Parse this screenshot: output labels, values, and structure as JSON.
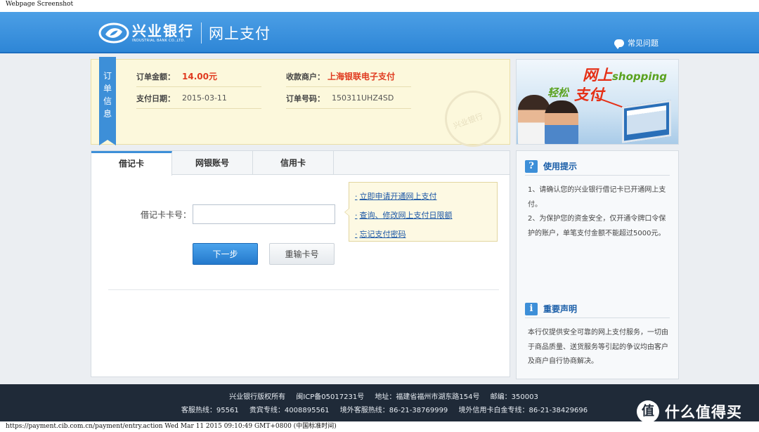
{
  "caption": "Webpage Screenshot",
  "header": {
    "bank_name": "兴业银行",
    "bank_name_en": "INDUSTRIAL BANK CO.,LTD.",
    "title": "网上支付",
    "faq_label": "常见问题"
  },
  "order": {
    "ribbon": [
      "订",
      "单",
      "信",
      "息"
    ],
    "amount_label": "订单金额：",
    "amount_value": "14.00元",
    "merchant_label": "收款商户：",
    "merchant_value": "上海银联电子支付",
    "date_label": "支付日期：",
    "date_value": "2015-03-11",
    "order_no_label": "订单号码：",
    "order_no_value": "150311UHZ4SD",
    "stamp_text": "兴业银行"
  },
  "banner": {
    "line1": "网上",
    "line1_en": "shopping",
    "line2_a": "轻松",
    "line2_b": "支付"
  },
  "tabs": [
    {
      "label": "借记卡",
      "active": true
    },
    {
      "label": "网银账号",
      "active": false
    },
    {
      "label": "信用卡",
      "active": false
    }
  ],
  "form": {
    "card_label": "借记卡卡号：",
    "card_value": "",
    "next_button": "下一步",
    "reset_button": "重输卡号"
  },
  "tips": {
    "links": [
      "立即申请开通网上支付",
      "查询、修改网上支付日限额",
      "忘记支付密码"
    ]
  },
  "side": {
    "usage_title": "使用提示",
    "usage_icon": "?",
    "usage_text_1": "1、请确认您的兴业银行借记卡已开通网上支付。",
    "usage_text_2": "2、为保护您的资金安全，仅开通令牌口令保护的账户，单笔支付金额不能超过5000元。",
    "notice_title": "重要声明",
    "notice_icon": "i",
    "notice_text": "本行仅提供安全可靠的网上支付服务，一切由于商品质量、送货服务等引起的争议均由客户及商户自行协商解决。"
  },
  "footer": {
    "copyright": "兴业银行版权所有",
    "icp": "闽ICP备05017231号",
    "address": "地址：福建省福州市湖东路154号",
    "postcode": "邮编：350003",
    "hotline": "客服热线：95561",
    "vip": "贵宾专线：4008895561",
    "overseas": "境外客服热线：86-21-38769999",
    "overseas_credit": "境外信用卡白金专线：86-21-38429696"
  },
  "watermark": {
    "logo": "值",
    "text": "什么值得买"
  },
  "statusbar": "https://payment.cib.com.cn/payment/entry.action Wed Mar 11 2015 09:10:49 GMT+0800 (中国标准时间)",
  "colors": {
    "header_blue": "#2e86d6",
    "accent_red": "#e03a1f",
    "link_blue": "#1a56a6",
    "footer_bg": "#1f2a38"
  }
}
